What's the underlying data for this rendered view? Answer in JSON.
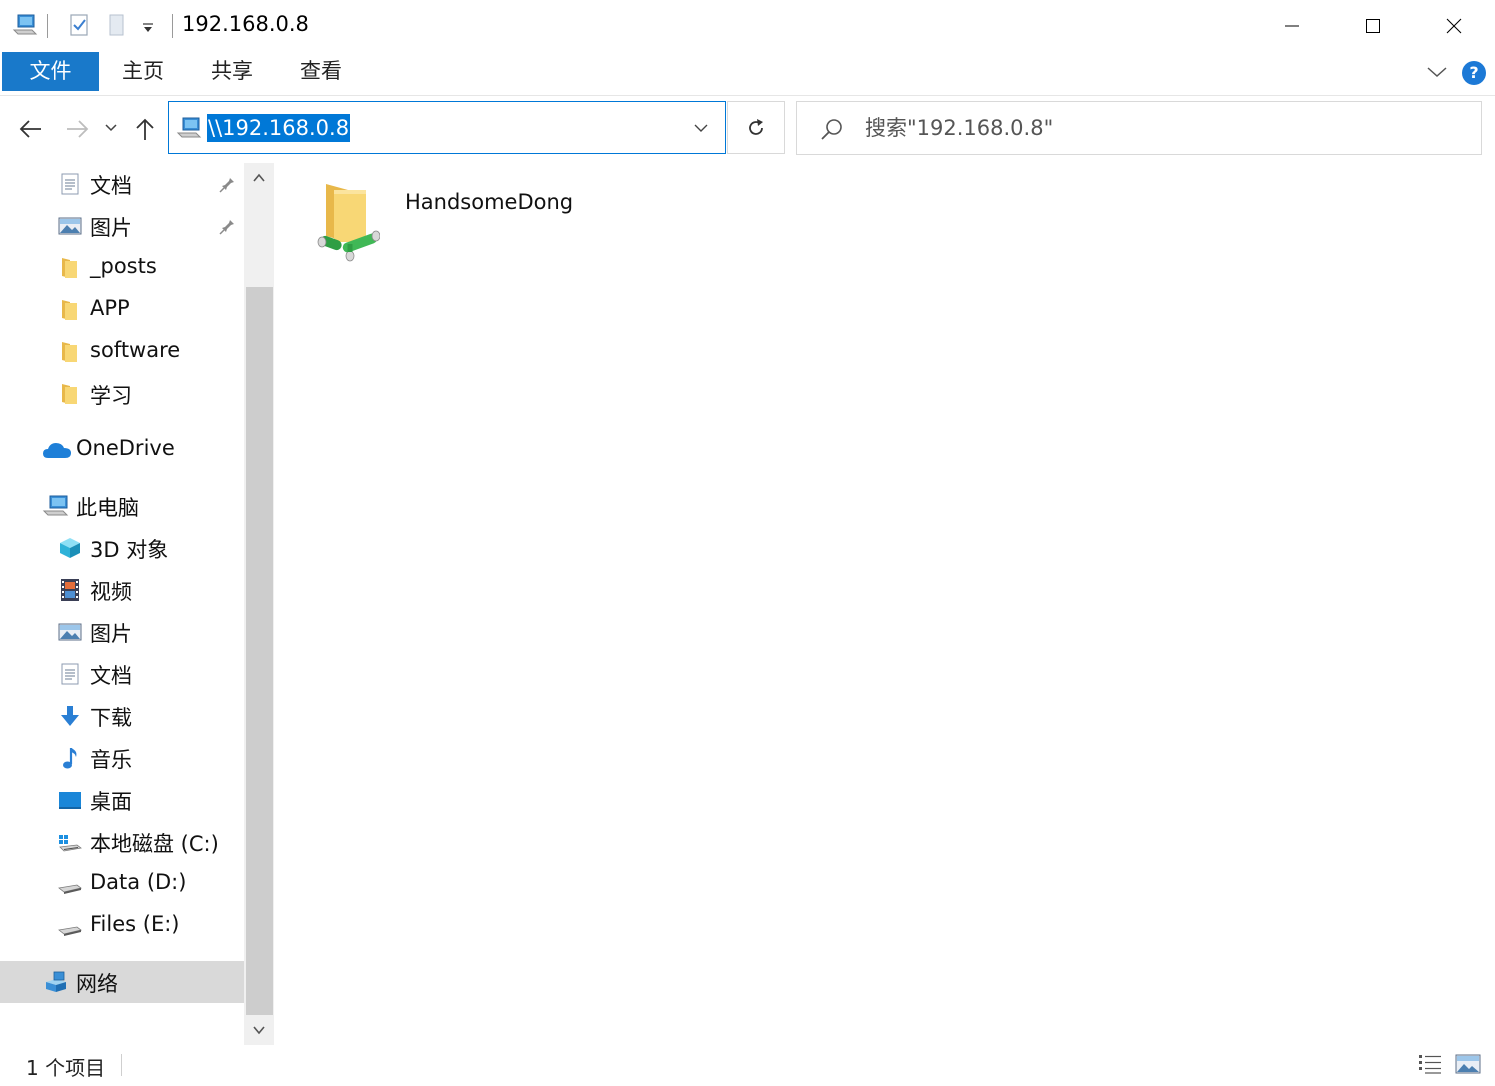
{
  "window": {
    "title": "192.168.0.8",
    "controls": {
      "minimize": "minimize",
      "maximize": "maximize",
      "close": "close"
    }
  },
  "ribbon": {
    "tabs": [
      {
        "label": "文件",
        "active": true
      },
      {
        "label": "主页"
      },
      {
        "label": "共享"
      },
      {
        "label": "查看"
      }
    ],
    "help": "?"
  },
  "address": {
    "path": "\\\\192.168.0.8"
  },
  "search": {
    "placeholder": "搜索\"192.168.0.8\""
  },
  "nav": {
    "quick_access": [
      {
        "label": "文档",
        "icon": "documents-icon",
        "pinned": true
      },
      {
        "label": "图片",
        "icon": "pictures-icon",
        "pinned": true
      },
      {
        "label": "_posts",
        "icon": "folder-icon"
      },
      {
        "label": "APP",
        "icon": "folder-icon"
      },
      {
        "label": "software",
        "icon": "folder-icon"
      },
      {
        "label": "学习",
        "icon": "folder-icon"
      }
    ],
    "onedrive": {
      "label": "OneDrive",
      "icon": "onedrive-icon"
    },
    "this_pc": {
      "label": "此电脑",
      "icon": "computer-icon"
    },
    "pc_items": [
      {
        "label": "3D 对象",
        "icon": "3d-objects-icon"
      },
      {
        "label": "视频",
        "icon": "videos-icon"
      },
      {
        "label": "图片",
        "icon": "pictures-icon"
      },
      {
        "label": "文档",
        "icon": "documents-icon"
      },
      {
        "label": "下载",
        "icon": "downloads-icon"
      },
      {
        "label": "音乐",
        "icon": "music-icon"
      },
      {
        "label": "桌面",
        "icon": "desktop-icon"
      },
      {
        "label": "本地磁盘 (C:)",
        "icon": "windows-drive-icon"
      },
      {
        "label": "Data (D:)",
        "icon": "drive-icon"
      },
      {
        "label": "Files (E:)",
        "icon": "drive-icon"
      }
    ],
    "network": {
      "label": "网络",
      "icon": "network-icon",
      "selected": true
    }
  },
  "content": {
    "items": [
      {
        "name": "HandsomeDong",
        "icon": "shared-folder-icon"
      }
    ]
  },
  "status": {
    "item_count": "1 个项目"
  },
  "colors": {
    "accent": "#0078d7",
    "file_tab": "#1979ca",
    "folder": "#f8d775",
    "selected_nav": "#d9d9d9"
  }
}
